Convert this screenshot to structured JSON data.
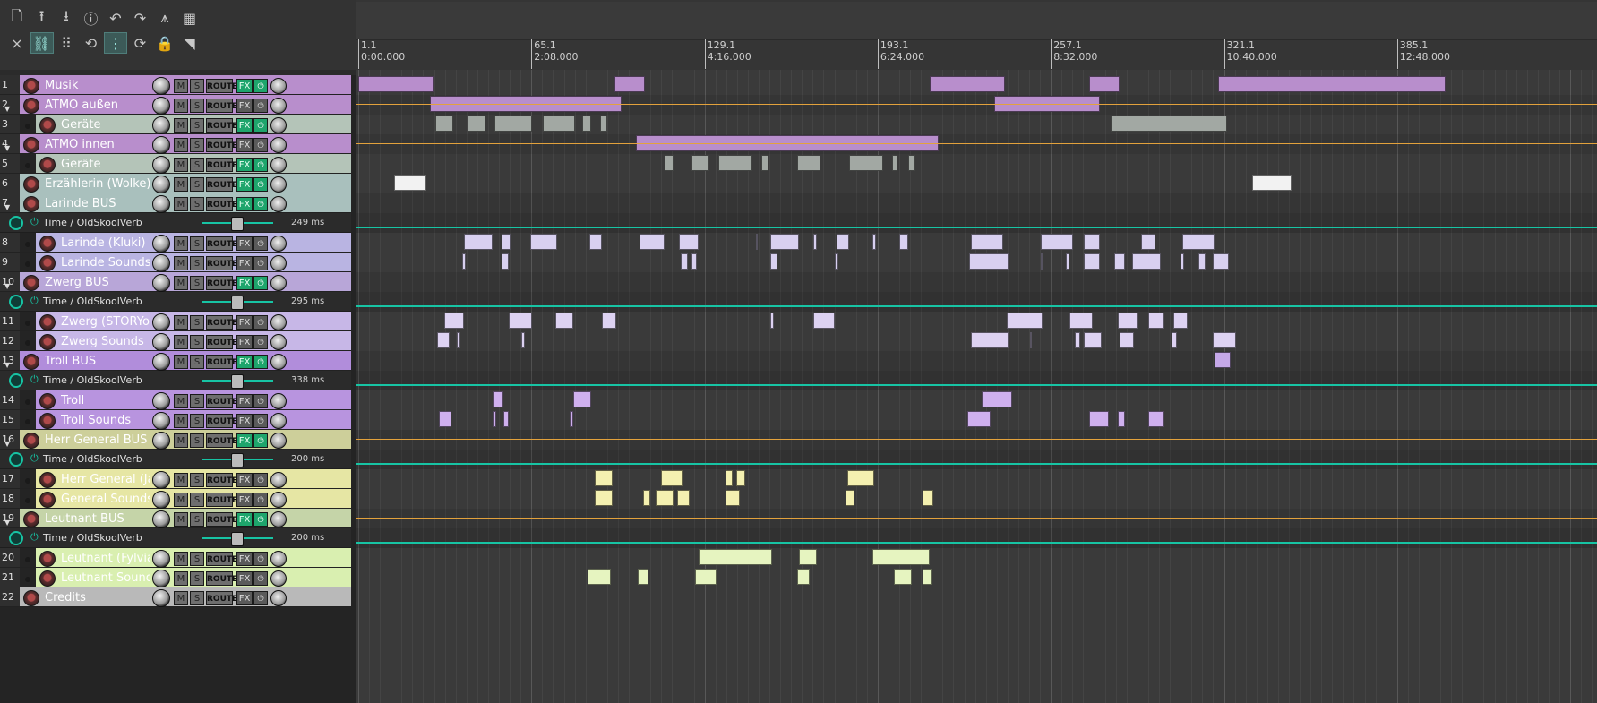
{
  "toolbar": {
    "row1": [
      {
        "icon": "new-project-icon",
        "glyph": "🗋"
      },
      {
        "icon": "open-project-icon",
        "glyph": "⭱"
      },
      {
        "icon": "save-project-icon",
        "glyph": "⭳"
      },
      {
        "icon": "project-info-icon",
        "glyph": "ⓘ"
      },
      {
        "icon": "undo-icon",
        "glyph": "↶"
      },
      {
        "icon": "redo-icon",
        "glyph": "↷"
      },
      {
        "icon": "metronome-icon",
        "glyph": "⩚"
      },
      {
        "icon": "grid-select-icon",
        "glyph": "▦"
      }
    ],
    "row2": [
      {
        "icon": "ripple-edit-icon",
        "glyph": "⨯",
        "active": false
      },
      {
        "icon": "link-icon",
        "glyph": "⛓",
        "active": true
      },
      {
        "icon": "grid-icon",
        "glyph": "⠿",
        "active": false
      },
      {
        "icon": "auto-crossfade-icon",
        "glyph": "⟲",
        "active": false
      },
      {
        "icon": "snap-icon",
        "glyph": "⋮",
        "active": true
      },
      {
        "icon": "loop-icon",
        "glyph": "⟳",
        "active": false
      },
      {
        "icon": "lock-icon",
        "glyph": "🔒",
        "active": false
      },
      {
        "icon": "envelope-draw-icon",
        "glyph": "◥",
        "active": false
      }
    ]
  },
  "ruler": {
    "markers": [
      {
        "measure": "1.1",
        "time": "0:00.000"
      },
      {
        "measure": "65.1",
        "time": "2:08.000"
      },
      {
        "measure": "129.1",
        "time": "4:16.000"
      },
      {
        "measure": "193.1",
        "time": "6:24.000"
      },
      {
        "measure": "257.1",
        "time": "8:32.000"
      },
      {
        "measure": "321.1",
        "time": "10:40.000"
      },
      {
        "measure": "385.1",
        "time": "12:48.000"
      }
    ]
  },
  "tracks": [
    {
      "kind": "track",
      "num": "1",
      "name": "Musik",
      "color": "#b88ecc",
      "nameColor": "#ffffff",
      "indent": 0,
      "folder": false,
      "fx": true,
      "fxOn": true,
      "nameColorOn": "#ffffff"
    },
    {
      "kind": "track",
      "num": "2",
      "name": "ATMO außen",
      "color": "#b88ecc",
      "nameColor": "#ffffff",
      "indent": 0,
      "folder": true,
      "fx": false
    },
    {
      "kind": "track",
      "num": "3",
      "name": "Geräte",
      "color": "#b4c4b8",
      "nameColor": "#ffffff",
      "indent": 1,
      "folder": false,
      "fx": true
    },
    {
      "kind": "track",
      "num": "4",
      "name": "ATMO innen",
      "color": "#b88ecc",
      "nameColor": "#ffffff",
      "indent": 0,
      "folder": true,
      "fx": false
    },
    {
      "kind": "track",
      "num": "5",
      "name": "Geräte",
      "color": "#b4c4b8",
      "nameColor": "#ffffff",
      "indent": 1,
      "folder": false,
      "fx": true
    },
    {
      "kind": "track",
      "num": "6",
      "name": "Erzählerin (Wolke)",
      "color": "#a9c0bd",
      "nameColor": "#ffffff",
      "indent": 0,
      "folder": false,
      "fx": true
    },
    {
      "kind": "track",
      "num": "7",
      "name": "Larinde BUS",
      "color": "#a9c0bd",
      "nameColor": "#ffffff",
      "indent": 0,
      "folder": true,
      "fx": true
    },
    {
      "kind": "fx",
      "label": "Time / OldSkoolVerb",
      "value": "249 ms"
    },
    {
      "kind": "track",
      "num": "8",
      "name": "Larinde  (Kluki)",
      "color": "#b9b4e2",
      "nameColor": "#ffffff",
      "indent": 1,
      "folder": false,
      "fx": false
    },
    {
      "kind": "track",
      "num": "9",
      "name": "Larinde Sounds",
      "color": "#b9b4e2",
      "nameColor": "#ffffff",
      "indent": 1,
      "folder": false,
      "fx": false
    },
    {
      "kind": "track",
      "num": "10",
      "name": "Zwerg BUS",
      "color": "#b8a6d8",
      "nameColor": "#ffffff",
      "indent": 0,
      "folder": true,
      "fx": true
    },
    {
      "kind": "fx",
      "label": "Time / OldSkoolVerb",
      "value": "295 ms"
    },
    {
      "kind": "track",
      "num": "11",
      "name": "Zwerg (STORYosh",
      "color": "#c7b7e7",
      "nameColor": "#ffffff",
      "indent": 1,
      "folder": false,
      "fx": false
    },
    {
      "kind": "track",
      "num": "12",
      "name": "Zwerg Sounds",
      "color": "#c7b7e7",
      "nameColor": "#ffffff",
      "indent": 1,
      "folder": false,
      "fx": false
    },
    {
      "kind": "track",
      "num": "13",
      "name": "Troll BUS",
      "color": "#b18ddb",
      "nameColor": "#ffffff",
      "indent": 0,
      "folder": true,
      "fx": true
    },
    {
      "kind": "fx",
      "label": "Time / OldSkoolVerb",
      "value": "338 ms"
    },
    {
      "kind": "track",
      "num": "14",
      "name": "Troll",
      "color": "#b894df",
      "nameColor": "#ffffff",
      "indent": 1,
      "folder": false,
      "fx": false
    },
    {
      "kind": "track",
      "num": "15",
      "name": "Troll Sounds",
      "color": "#b894df",
      "nameColor": "#ffffff",
      "indent": 1,
      "folder": false,
      "fx": false
    },
    {
      "kind": "track",
      "num": "16",
      "name": "Herr General BUS",
      "color": "#cdcf9a",
      "nameColor": "#ffffff",
      "indent": 0,
      "folder": true,
      "fx": true
    },
    {
      "kind": "fx",
      "label": "Time / OldSkoolVerb",
      "value": "200 ms"
    },
    {
      "kind": "track",
      "num": "17",
      "name": "Herr General (Jan)",
      "color": "#e6e6a4",
      "nameColor": "#ffffff",
      "indent": 1,
      "folder": false,
      "fx": false
    },
    {
      "kind": "track",
      "num": "18",
      "name": "General Sounds",
      "color": "#e6e6a4",
      "nameColor": "#ffffff",
      "indent": 1,
      "folder": false,
      "fx": false
    },
    {
      "kind": "track",
      "num": "19",
      "name": "Leutnant BUS",
      "color": "#c5d4a8",
      "nameColor": "#ffffff",
      "indent": 0,
      "folder": true,
      "fx": true
    },
    {
      "kind": "fx",
      "label": "Time / OldSkoolVerb",
      "value": "200 ms"
    },
    {
      "kind": "track",
      "num": "20",
      "name": "Leutnant (Fylvia)",
      "color": "#d9efb0",
      "nameColor": "#ffffff",
      "indent": 1,
      "folder": false,
      "fx": false
    },
    {
      "kind": "track",
      "num": "21",
      "name": "Leutnant Sounds",
      "color": "#d9efb0",
      "nameColor": "#ffffff",
      "indent": 1,
      "folder": false,
      "fx": false
    },
    {
      "kind": "track",
      "num": "22",
      "name": "Credits",
      "color": "#b9b9b9",
      "nameColor": "#ffffff",
      "indent": 0,
      "folder": false,
      "fx": false
    }
  ],
  "button_labels": {
    "mute": "M",
    "solo": "S",
    "route": "ROUTE",
    "fx": "FX",
    "power": "⏻"
  },
  "colors": {
    "automation_teal": "#17c4a4",
    "volume_env": "#e3a23c",
    "fx_green": "#1ea56c"
  }
}
